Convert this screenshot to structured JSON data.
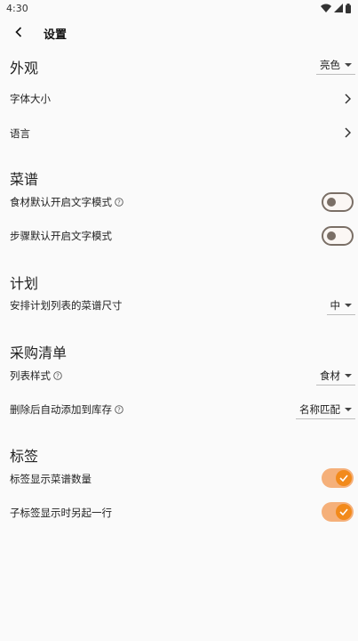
{
  "status_bar": {
    "time": "4:30"
  },
  "header": {
    "title": "设置"
  },
  "sections": {
    "appearance": {
      "title": "外观",
      "theme_value": "亮色",
      "font_size_label": "字体大小",
      "language_label": "语言"
    },
    "recipes": {
      "title": "菜谱",
      "ingredient_text_mode_label": "食材默认开启文字模式",
      "step_text_mode_label": "步骤默认开启文字模式",
      "ingredient_text_mode_on": false,
      "step_text_mode_on": false
    },
    "plan": {
      "title": "计划",
      "recipe_size_label": "安排计划列表的菜谱尺寸",
      "recipe_size_value": "中"
    },
    "shopping_list": {
      "title": "采购清单",
      "list_style_label": "列表样式",
      "list_style_value": "食材",
      "auto_add_label": "删除后自动添加到库存",
      "auto_add_value": "名称匹配"
    },
    "tags": {
      "title": "标签",
      "show_recipe_count_label": "标签显示菜谱数量",
      "subtag_new_line_label": "子标签显示时另起一行",
      "show_recipe_count_on": true,
      "subtag_new_line_on": true
    }
  },
  "colors": {
    "accent": "#f28a1b",
    "accent_track": "#f5b07a",
    "switch_off": "#7a6f66"
  }
}
